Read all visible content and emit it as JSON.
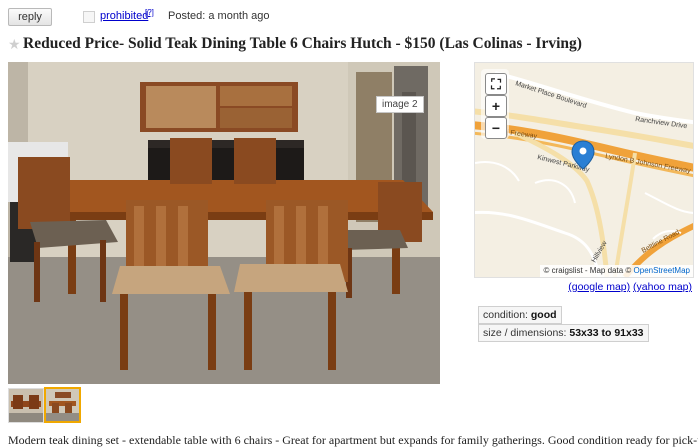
{
  "topbar": {
    "reply_label": "reply",
    "flag_label": "prohibited",
    "flag_help": "[?]",
    "posted": "Posted: a month ago"
  },
  "listing": {
    "title": "Reduced Price- Solid Teak Dining Table 6 Chairs Hutch - $150 (Las Colinas - Irving)",
    "image_label": "image 2",
    "description": "Modern teak dining set - extendable table with 6 chairs - Great for apartment but expands for family gatherings. Good condition ready for pick-up."
  },
  "map": {
    "streets": [
      "Market Place Boulevard",
      "Ranchview Drive",
      "Lbj Freeway",
      "Kinwest Parkway",
      "Lyndon B Johnson Freeway",
      "Beltline Road",
      "Hillview"
    ],
    "attribution_prefix": "© craigslist - Map data ©",
    "attribution_link": "OpenStreetMap",
    "google_link": "(google map)",
    "yahoo_link": "(yahoo map)"
  },
  "attributes": [
    {
      "label": "condition:",
      "value": "good"
    },
    {
      "label": "size / dimensions:",
      "value": "53x33 to 91x33"
    }
  ],
  "icons": [
    "star-icon",
    "fullscreen-icon",
    "zoom-in-icon",
    "zoom-out-icon",
    "map-marker-icon"
  ],
  "colors": {
    "link": "#0000cc",
    "marker": "#2a7fd4",
    "highway": "#f0a23a",
    "thumb_selected": "#f0a800"
  }
}
